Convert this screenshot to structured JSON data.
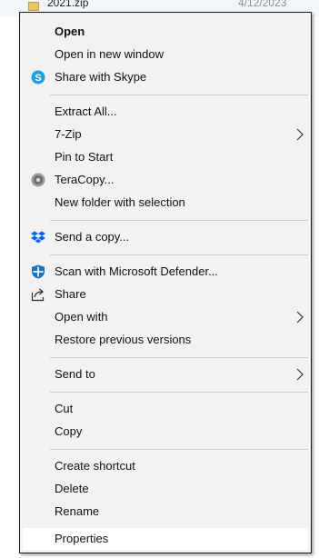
{
  "background": {
    "file_name": "2021.zip",
    "file_date": "4/12/2023"
  },
  "menu": {
    "items": [
      {
        "label": "Open"
      },
      {
        "label": "Open in new window"
      },
      {
        "label": "Share with Skype",
        "icon": "skype-icon"
      },
      {
        "label": "Extract All..."
      },
      {
        "label": "7-Zip",
        "icon": "chevron-right-icon"
      },
      {
        "label": "Pin to Start"
      },
      {
        "label": "TeraCopy...",
        "icon": "teracopy-icon"
      },
      {
        "label": "New folder with selection"
      },
      {
        "label": "Send a copy...",
        "icon": "dropbox-icon"
      },
      {
        "label": "Scan with Microsoft Defender...",
        "icon": "defender-shield-icon"
      },
      {
        "label": "Share",
        "icon": "share-icon"
      },
      {
        "label": "Open with",
        "icon": "chevron-right-icon"
      },
      {
        "label": "Restore previous versions"
      },
      {
        "label": "Send to",
        "icon": "chevron-right-icon"
      },
      {
        "label": "Cut"
      },
      {
        "label": "Copy"
      },
      {
        "label": "Create shortcut"
      },
      {
        "label": "Delete"
      },
      {
        "label": "Rename"
      },
      {
        "label": "Properties"
      }
    ]
  },
  "colors": {
    "menu_background": "#f2f2f2",
    "highlight": "#ffffff",
    "skype_blue": "#1a9fe0",
    "dropbox_blue": "#0061fe",
    "defender_blue": "#1e6fbd"
  }
}
